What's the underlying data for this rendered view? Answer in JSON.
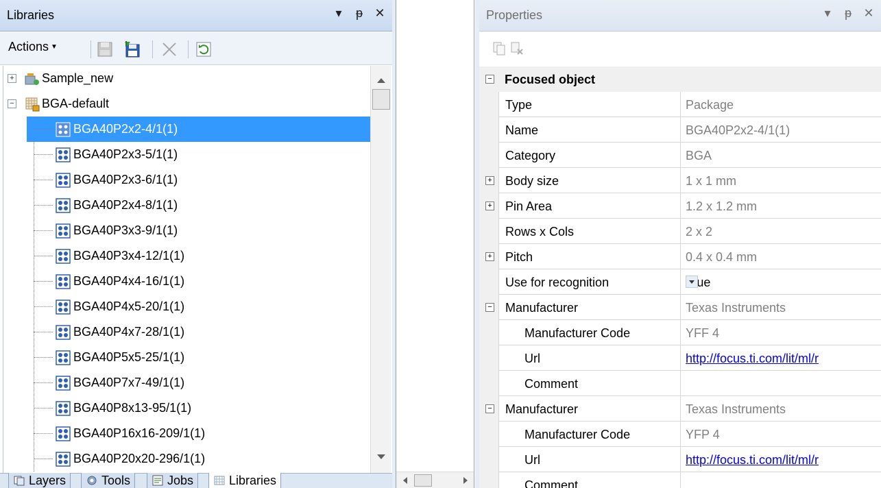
{
  "libraries_panel": {
    "title": "Libraries",
    "title_buttons": [
      "▾",
      "ᵽ",
      "✕"
    ],
    "toolbar": {
      "actions_label": "Actions"
    },
    "tree": {
      "top_nodes": [
        {
          "label": "Sample_new",
          "expanded": false
        },
        {
          "label": "BGA-default",
          "expanded": true
        }
      ],
      "children": [
        "BGA40P2x2-4/1(1)",
        "BGA40P2x3-5/1(1)",
        "BGA40P2x3-6/1(1)",
        "BGA40P2x4-8/1(1)",
        "BGA40P3x3-9/1(1)",
        "BGA40P3x4-12/1(1)",
        "BGA40P4x4-16/1(1)",
        "BGA40P4x5-20/1(1)",
        "BGA40P4x7-28/1(1)",
        "BGA40P5x5-25/1(1)",
        "BGA40P7x7-49/1(1)",
        "BGA40P8x13-95/1(1)",
        "BGA40P16x16-209/1(1)",
        "BGA40P20x20-296/1(1)"
      ],
      "selected_index": 0
    },
    "tabs": [
      "Layers",
      "Tools",
      "Jobs",
      "Libraries"
    ],
    "active_tab": "Libraries"
  },
  "properties_panel": {
    "title": "Properties",
    "title_buttons": [
      "▾",
      "ᵽ",
      "✕"
    ],
    "category": "Focused object",
    "rows": {
      "type": {
        "name": "Type",
        "value": "Package"
      },
      "name": {
        "name": "Name",
        "value": "BGA40P2x2-4/1(1)"
      },
      "category": {
        "name": "Category",
        "value": "BGA"
      },
      "body_size": {
        "name": "Body size",
        "value": "1 x 1 mm"
      },
      "pin_area": {
        "name": "Pin Area",
        "value": "1.2 x 1.2 mm"
      },
      "rows_cols": {
        "name": "Rows x Cols",
        "value": "2 x 2"
      },
      "pitch": {
        "name": "Pitch",
        "value": "0.4 x 0.4 mm"
      },
      "use_for_recognition": {
        "name": "Use for recognition",
        "value": "True"
      },
      "manufacturer1": {
        "name": "Manufacturer",
        "value": "Texas Instruments"
      },
      "mcode1": {
        "name": "Manufacturer Code",
        "value": "YFF 4"
      },
      "url1": {
        "name": "Url",
        "value": "http://focus.ti.com/lit/ml/r"
      },
      "comment1": {
        "name": "Comment",
        "value": ""
      },
      "manufacturer2": {
        "name": "Manufacturer",
        "value": "Texas Instruments"
      },
      "mcode2": {
        "name": "Manufacturer Code",
        "value": "YFP 4"
      },
      "url2": {
        "name": "Url",
        "value": "http://focus.ti.com/lit/ml/r"
      },
      "comment2": {
        "name": "Comment",
        "value": ""
      }
    },
    "expander_signs": {
      "plus": "+",
      "minus": "−"
    }
  },
  "colors": {
    "selection": "#3399ff",
    "titlebar": "#c9daf0",
    "link": "#0000ee"
  }
}
